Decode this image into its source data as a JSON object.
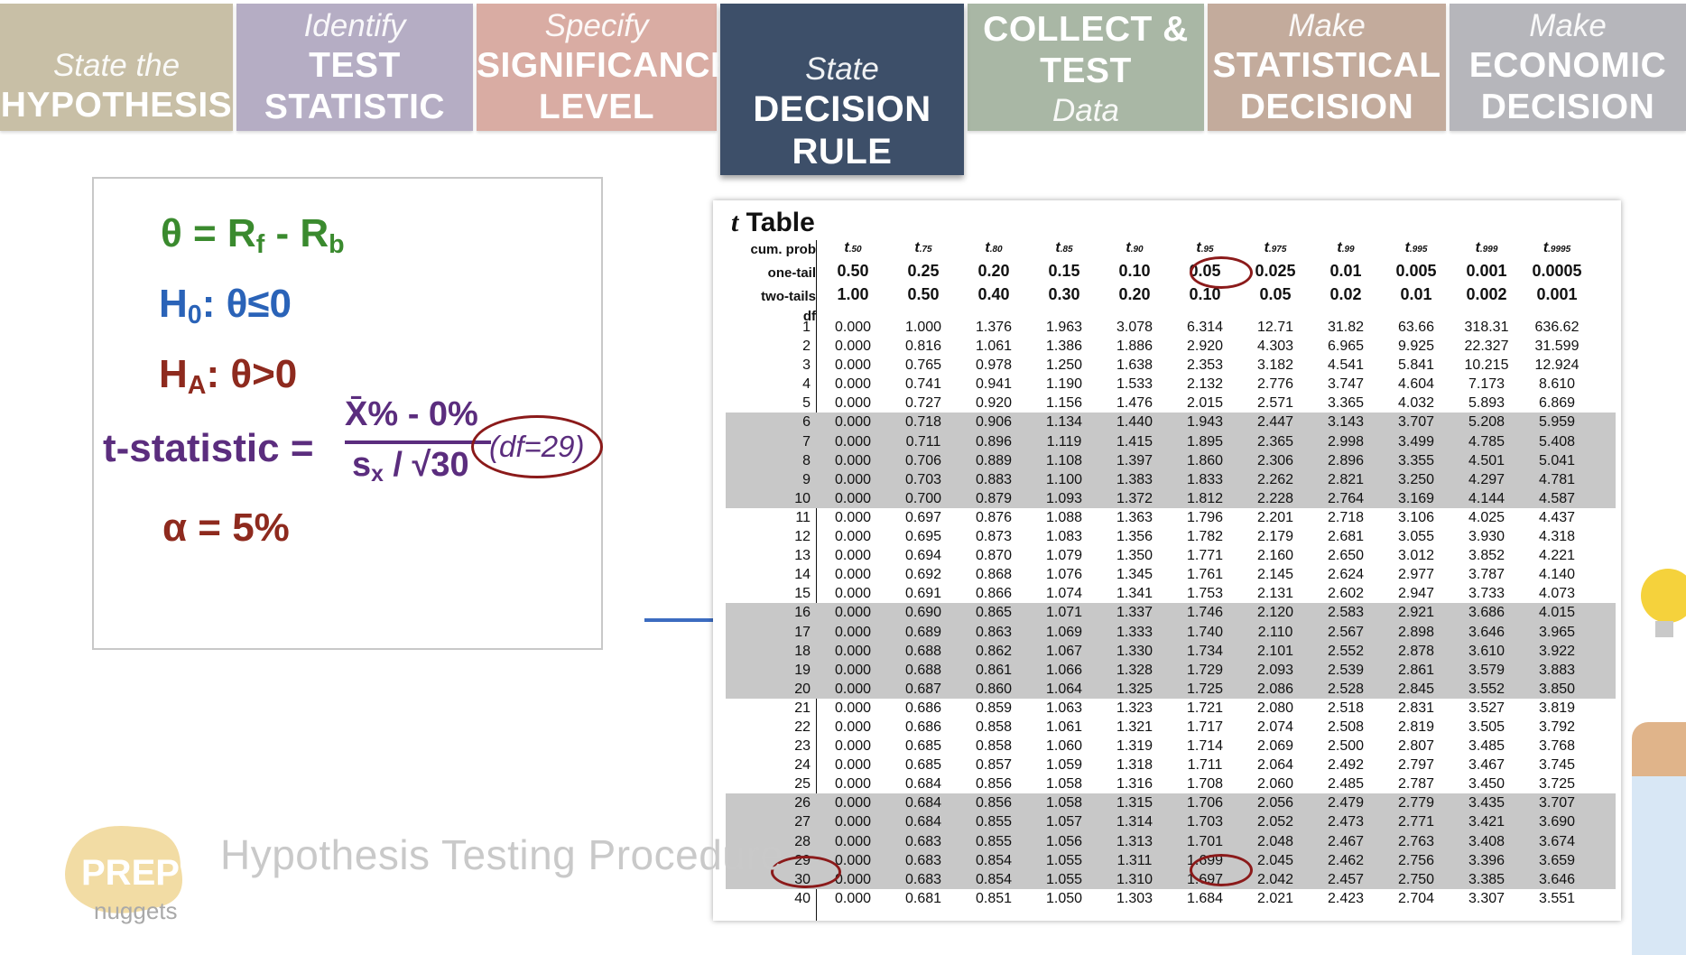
{
  "steps": [
    {
      "line1": "State the",
      "line2": "HYPOTHESIS",
      "line3": "",
      "color": "#c8bfa6"
    },
    {
      "line1": "Identify",
      "line2": "TEST",
      "line3": "STATISTIC",
      "color": "#b5adc4"
    },
    {
      "line1": "Specify",
      "line2": "SIGNIFICANCE",
      "line3": "LEVEL",
      "color": "#d9aca3"
    },
    {
      "line1": "State",
      "line2": "DECISION",
      "line3": "RULE",
      "color": "#3d4f69"
    },
    {
      "line1": "COLLECT &",
      "line2": "TEST",
      "line3": "Data",
      "color": "#a9b7a5"
    },
    {
      "line1": "Make",
      "line2": "STATISTICAL",
      "line3": "DECISION",
      "color": "#c3ab9c"
    },
    {
      "line1": "Make",
      "line2": "ECONOMIC",
      "line3": "DECISION",
      "color": "#b6b6bb"
    }
  ],
  "formulas": {
    "theta": "θ = R",
    "theta_f": "f",
    "theta_mid": " - R",
    "theta_b": "b",
    "h0": "H",
    "h0_sub": "0",
    "h0_rest": ": θ≤0",
    "ha": "H",
    "ha_sub": "A",
    "ha_rest": ": θ>0",
    "tstat_label": "t-statistic =",
    "numerator": "X̄% - 0%",
    "denom_s": "s",
    "denom_x": "x",
    "denom_rest": " / √30",
    "df_note": "(df=29)",
    "alpha": "α = 5%",
    "colors": {
      "theta": "#3a8a2e",
      "h0": "#2a63b8",
      "ha": "#8e2a1e",
      "tstat": "#5b2d7e",
      "alpha": "#8e2a1e"
    }
  },
  "ttable": {
    "title_t": "t",
    "title_rest": " Table",
    "row_labels": {
      "cum": "cum. prob",
      "one": "one-tail",
      "two": "two-tails",
      "df": "df"
    },
    "columns": [
      {
        "t": "t",
        "sub": ".50",
        "one": "0.50",
        "two": "1.00"
      },
      {
        "t": "t",
        "sub": ".75",
        "one": "0.25",
        "two": "0.50"
      },
      {
        "t": "t",
        "sub": ".80",
        "one": "0.20",
        "two": "0.40"
      },
      {
        "t": "t",
        "sub": ".85",
        "one": "0.15",
        "two": "0.30"
      },
      {
        "t": "t",
        "sub": ".90",
        "one": "0.10",
        "two": "0.20"
      },
      {
        "t": "t",
        "sub": ".95",
        "one": "0.05",
        "two": "0.10"
      },
      {
        "t": "t",
        "sub": ".975",
        "one": "0.025",
        "two": "0.05"
      },
      {
        "t": "t",
        "sub": ".99",
        "one": "0.01",
        "two": "0.02"
      },
      {
        "t": "t",
        "sub": ".995",
        "one": "0.005",
        "two": "0.01"
      },
      {
        "t": "t",
        "sub": ".999",
        "one": "0.001",
        "two": "0.002"
      },
      {
        "t": "t",
        "sub": ".9995",
        "one": "0.0005",
        "two": "0.001"
      }
    ],
    "rows": [
      [
        "1",
        "0.000",
        "1.000",
        "1.376",
        "1.963",
        "3.078",
        "6.314",
        "12.71",
        "31.82",
        "63.66",
        "318.31",
        "636.62"
      ],
      [
        "2",
        "0.000",
        "0.816",
        "1.061",
        "1.386",
        "1.886",
        "2.920",
        "4.303",
        "6.965",
        "9.925",
        "22.327",
        "31.599"
      ],
      [
        "3",
        "0.000",
        "0.765",
        "0.978",
        "1.250",
        "1.638",
        "2.353",
        "3.182",
        "4.541",
        "5.841",
        "10.215",
        "12.924"
      ],
      [
        "4",
        "0.000",
        "0.741",
        "0.941",
        "1.190",
        "1.533",
        "2.132",
        "2.776",
        "3.747",
        "4.604",
        "7.173",
        "8.610"
      ],
      [
        "5",
        "0.000",
        "0.727",
        "0.920",
        "1.156",
        "1.476",
        "2.015",
        "2.571",
        "3.365",
        "4.032",
        "5.893",
        "6.869"
      ],
      [
        "6",
        "0.000",
        "0.718",
        "0.906",
        "1.134",
        "1.440",
        "1.943",
        "2.447",
        "3.143",
        "3.707",
        "5.208",
        "5.959"
      ],
      [
        "7",
        "0.000",
        "0.711",
        "0.896",
        "1.119",
        "1.415",
        "1.895",
        "2.365",
        "2.998",
        "3.499",
        "4.785",
        "5.408"
      ],
      [
        "8",
        "0.000",
        "0.706",
        "0.889",
        "1.108",
        "1.397",
        "1.860",
        "2.306",
        "2.896",
        "3.355",
        "4.501",
        "5.041"
      ],
      [
        "9",
        "0.000",
        "0.703",
        "0.883",
        "1.100",
        "1.383",
        "1.833",
        "2.262",
        "2.821",
        "3.250",
        "4.297",
        "4.781"
      ],
      [
        "10",
        "0.000",
        "0.700",
        "0.879",
        "1.093",
        "1.372",
        "1.812",
        "2.228",
        "2.764",
        "3.169",
        "4.144",
        "4.587"
      ],
      [
        "11",
        "0.000",
        "0.697",
        "0.876",
        "1.088",
        "1.363",
        "1.796",
        "2.201",
        "2.718",
        "3.106",
        "4.025",
        "4.437"
      ],
      [
        "12",
        "0.000",
        "0.695",
        "0.873",
        "1.083",
        "1.356",
        "1.782",
        "2.179",
        "2.681",
        "3.055",
        "3.930",
        "4.318"
      ],
      [
        "13",
        "0.000",
        "0.694",
        "0.870",
        "1.079",
        "1.350",
        "1.771",
        "2.160",
        "2.650",
        "3.012",
        "3.852",
        "4.221"
      ],
      [
        "14",
        "0.000",
        "0.692",
        "0.868",
        "1.076",
        "1.345",
        "1.761",
        "2.145",
        "2.624",
        "2.977",
        "3.787",
        "4.140"
      ],
      [
        "15",
        "0.000",
        "0.691",
        "0.866",
        "1.074",
        "1.341",
        "1.753",
        "2.131",
        "2.602",
        "2.947",
        "3.733",
        "4.073"
      ],
      [
        "16",
        "0.000",
        "0.690",
        "0.865",
        "1.071",
        "1.337",
        "1.746",
        "2.120",
        "2.583",
        "2.921",
        "3.686",
        "4.015"
      ],
      [
        "17",
        "0.000",
        "0.689",
        "0.863",
        "1.069",
        "1.333",
        "1.740",
        "2.110",
        "2.567",
        "2.898",
        "3.646",
        "3.965"
      ],
      [
        "18",
        "0.000",
        "0.688",
        "0.862",
        "1.067",
        "1.330",
        "1.734",
        "2.101",
        "2.552",
        "2.878",
        "3.610",
        "3.922"
      ],
      [
        "19",
        "0.000",
        "0.688",
        "0.861",
        "1.066",
        "1.328",
        "1.729",
        "2.093",
        "2.539",
        "2.861",
        "3.579",
        "3.883"
      ],
      [
        "20",
        "0.000",
        "0.687",
        "0.860",
        "1.064",
        "1.325",
        "1.725",
        "2.086",
        "2.528",
        "2.845",
        "3.552",
        "3.850"
      ],
      [
        "21",
        "0.000",
        "0.686",
        "0.859",
        "1.063",
        "1.323",
        "1.721",
        "2.080",
        "2.518",
        "2.831",
        "3.527",
        "3.819"
      ],
      [
        "22",
        "0.000",
        "0.686",
        "0.858",
        "1.061",
        "1.321",
        "1.717",
        "2.074",
        "2.508",
        "2.819",
        "3.505",
        "3.792"
      ],
      [
        "23",
        "0.000",
        "0.685",
        "0.858",
        "1.060",
        "1.319",
        "1.714",
        "2.069",
        "2.500",
        "2.807",
        "3.485",
        "3.768"
      ],
      [
        "24",
        "0.000",
        "0.685",
        "0.857",
        "1.059",
        "1.318",
        "1.711",
        "2.064",
        "2.492",
        "2.797",
        "3.467",
        "3.745"
      ],
      [
        "25",
        "0.000",
        "0.684",
        "0.856",
        "1.058",
        "1.316",
        "1.708",
        "2.060",
        "2.485",
        "2.787",
        "3.450",
        "3.725"
      ],
      [
        "26",
        "0.000",
        "0.684",
        "0.856",
        "1.058",
        "1.315",
        "1.706",
        "2.056",
        "2.479",
        "2.779",
        "3.435",
        "3.707"
      ],
      [
        "27",
        "0.000",
        "0.684",
        "0.855",
        "1.057",
        "1.314",
        "1.703",
        "2.052",
        "2.473",
        "2.771",
        "3.421",
        "3.690"
      ],
      [
        "28",
        "0.000",
        "0.683",
        "0.855",
        "1.056",
        "1.313",
        "1.701",
        "2.048",
        "2.467",
        "2.763",
        "3.408",
        "3.674"
      ],
      [
        "29",
        "0.000",
        "0.683",
        "0.854",
        "1.055",
        "1.311",
        "1.699",
        "2.045",
        "2.462",
        "2.756",
        "3.396",
        "3.659"
      ],
      [
        "30",
        "0.000",
        "0.683",
        "0.854",
        "1.055",
        "1.310",
        "1.697",
        "2.042",
        "2.457",
        "2.750",
        "3.385",
        "3.646"
      ],
      [
        "40",
        "0.000",
        "0.681",
        "0.851",
        "1.050",
        "1.303",
        "1.684",
        "2.021",
        "2.423",
        "2.704",
        "3.307",
        "3.551"
      ]
    ],
    "shaded_groups": [
      [
        6,
        10
      ],
      [
        16,
        20
      ],
      [
        26,
        30
      ]
    ]
  },
  "footer": {
    "title": "Hypothesis Testing Procedure",
    "logo_top": "PREP",
    "logo_bottom": "nuggets",
    "logo_color": "#f2dca4"
  }
}
